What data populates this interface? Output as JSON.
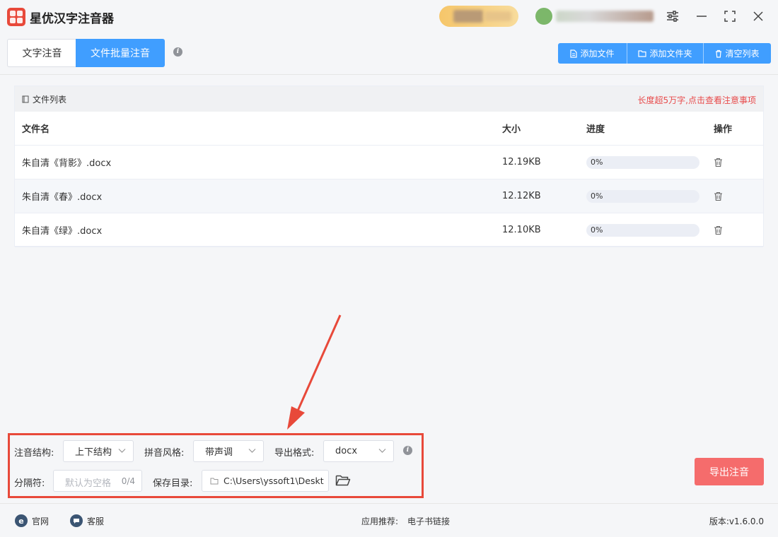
{
  "app": {
    "title": "星优汉字注音器"
  },
  "tabs": [
    {
      "label": "文字注音"
    },
    {
      "label": "文件批量注音"
    }
  ],
  "toolbar": {
    "add_file": "添加文件",
    "add_folder": "添加文件夹",
    "clear_list": "清空列表"
  },
  "file_list": {
    "title": "文件列表",
    "warning": "长度超5万字,点击查看注意事项",
    "columns": {
      "name": "文件名",
      "size": "大小",
      "progress": "进度",
      "action": "操作"
    },
    "rows": [
      {
        "name": "朱自清《背影》.docx",
        "size": "12.19KB",
        "progress": "0%",
        "progress_value": 0
      },
      {
        "name": "朱自清《春》.docx",
        "size": "12.12KB",
        "progress": "0%",
        "progress_value": 0
      },
      {
        "name": "朱自清《绿》.docx",
        "size": "12.10KB",
        "progress": "0%",
        "progress_value": 0
      }
    ]
  },
  "settings": {
    "structure_label": "注音结构:",
    "structure_value": "上下结构",
    "style_label": "拼音风格:",
    "style_value": "带声调",
    "format_label": "导出格式:",
    "format_value": "docx",
    "separator_label": "分隔符:",
    "separator_placeholder": "默认为空格",
    "separator_count": "0/4",
    "save_dir_label": "保存目录:",
    "save_dir_value": "C:\\Users\\yssoft1\\Deskt"
  },
  "export_button": "导出注音",
  "footer": {
    "website": "官网",
    "support": "客服",
    "recommend_label": "应用推荐:",
    "recommend_link": "电子书链接",
    "version": "版本:v1.6.0.0"
  },
  "colors": {
    "primary": "#409eff",
    "export": "#f56c6c",
    "highlight": "#e8493a",
    "warning_text": "#e84b4b"
  }
}
